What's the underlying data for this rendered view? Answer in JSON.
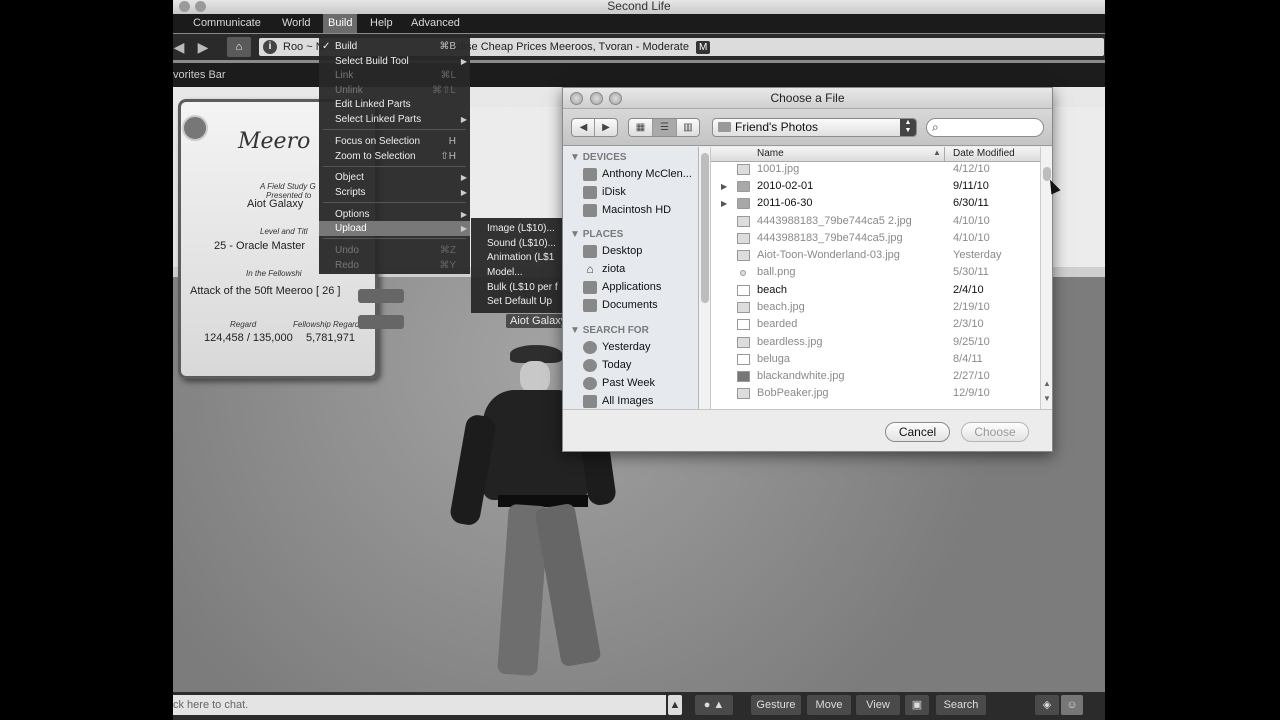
{
  "window": {
    "title": "Second Life"
  },
  "menubar": {
    "items": [
      "Communicate",
      "World",
      "Build",
      "Help",
      "Advanced"
    ]
  },
  "navbar": {
    "back": "◀",
    "forward": "▶",
    "home": "⌂",
    "location_start": "Roo ~ N",
    "location_rest": "radise Cheap Prices Meeroos, Tvoran - Moderate",
    "maturity_badge": "M"
  },
  "favorites": {
    "label": "vorites Bar"
  },
  "build_menu": {
    "items": [
      {
        "label": "Build",
        "shortcut": "⌘B",
        "checked": "✓"
      },
      {
        "label": "Select Build Tool",
        "arrow": "▶"
      },
      {
        "label": "Link",
        "shortcut": "⌘L"
      },
      {
        "label": "Unlink",
        "shortcut": "⌘⇧L"
      },
      {
        "label": "Edit Linked Parts"
      },
      {
        "label": "Select Linked Parts",
        "arrow": "▶"
      },
      {
        "label": "Focus on Selection",
        "shortcut": "H"
      },
      {
        "label": "Zoom to Selection",
        "shortcut": "⇧H"
      },
      {
        "label": "Object",
        "arrow": "▶"
      },
      {
        "label": "Scripts",
        "arrow": "▶"
      },
      {
        "label": "Options",
        "arrow": "▶"
      },
      {
        "label": "Upload",
        "arrow": "▶"
      },
      {
        "label": "Undo",
        "shortcut": "⌘Z"
      },
      {
        "label": "Redo",
        "shortcut": "⌘Y"
      }
    ]
  },
  "upload_menu": {
    "items": [
      "Image (L$10)...",
      "Sound (L$10)...",
      "Animation (L$1",
      "Model...",
      "Bulk (L$10 per f",
      "Set Default Up"
    ]
  },
  "poster": {
    "title": "Meero",
    "subtitle": "A Field Study G",
    "presented_to": "Presented to",
    "name": "Aiot Galaxy",
    "level_label": "Level and Titl",
    "level": "25 - Oracle Master",
    "fellowship_label": "In the Fellowshi",
    "fellowship": "Attack of the 50ft Meeroo [ 26 ]",
    "regard_label": "Regard",
    "fellowship_regard_label": "Fellowship Regard",
    "regard": "124,458 / 135,000",
    "fellowship_regard": "5,781,971"
  },
  "avatar": {
    "name_tag": "Aiot Galaxy"
  },
  "bottombar": {
    "chat_placeholder": "ck here to chat.",
    "gesture": "Gesture",
    "move": "Move",
    "view": "View",
    "search": "Search"
  },
  "dialog": {
    "title": "Choose a File",
    "location": "Friend's Photos",
    "search_placeholder": "",
    "sidebar": {
      "devices_header": "DEVICES",
      "devices": [
        "Anthony McClen...",
        "iDisk",
        "Macintosh HD"
      ],
      "places_header": "PLACES",
      "places": [
        "Desktop",
        "ziota",
        "Applications",
        "Documents"
      ],
      "search_header": "SEARCH FOR",
      "search_for": [
        "Yesterday",
        "Today",
        "Past Week",
        "All Images"
      ]
    },
    "columns": {
      "name": "Name",
      "date": "Date Modified"
    },
    "files": [
      {
        "name": "1001.jpg",
        "date": "4/12/10"
      },
      {
        "name": "2010-02-01",
        "date": "9/11/10"
      },
      {
        "name": "2011-06-30",
        "date": "6/30/11"
      },
      {
        "name": "4443988183_79be744ca5 2.jpg",
        "date": "4/10/10"
      },
      {
        "name": "4443988183_79be744ca5.jpg",
        "date": "4/10/10"
      },
      {
        "name": "Aiot-Toon-Wonderland-03.jpg",
        "date": "Yesterday"
      },
      {
        "name": "ball.png",
        "date": "5/30/11"
      },
      {
        "name": "beach",
        "date": "2/4/10"
      },
      {
        "name": "beach.jpg",
        "date": "2/19/10"
      },
      {
        "name": "bearded",
        "date": "2/3/10"
      },
      {
        "name": "beardless.jpg",
        "date": "9/25/10"
      },
      {
        "name": "beluga",
        "date": "8/4/11"
      },
      {
        "name": "blackandwhite.jpg",
        "date": "2/27/10"
      },
      {
        "name": "BobPeaker.jpg",
        "date": "12/9/10"
      }
    ],
    "cancel": "Cancel",
    "choose": "Choose"
  },
  "colors": {
    "menu_bg": "#1b1b1b",
    "menu_highlight": "#787878",
    "dialog_bg": "#ececec"
  }
}
